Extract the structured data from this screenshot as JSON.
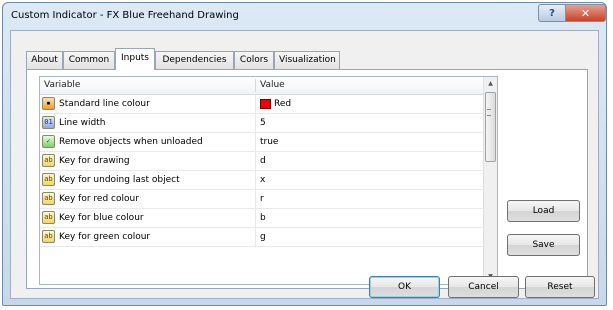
{
  "window": {
    "title": "Custom Indicator - FX Blue Freehand Drawing",
    "help_label": "?",
    "close_label": "✕"
  },
  "tabs": [
    {
      "label": "About",
      "active": false
    },
    {
      "label": "Common",
      "active": false
    },
    {
      "label": "Inputs",
      "active": true
    },
    {
      "label": "Dependencies",
      "active": false
    },
    {
      "label": "Colors",
      "active": false
    },
    {
      "label": "Visualization",
      "active": false
    }
  ],
  "grid": {
    "headers": {
      "variable": "Variable",
      "value": "Value"
    },
    "rows": [
      {
        "icon": "color-icon",
        "variable": "Standard line colour",
        "value": "Red",
        "swatch": "#ee0000"
      },
      {
        "icon": "number-icon",
        "variable": "Line width",
        "value": "5"
      },
      {
        "icon": "bool-icon",
        "variable": "Remove objects when unloaded",
        "value": "true"
      },
      {
        "icon": "text-icon",
        "variable": "Key for drawing",
        "value": "d"
      },
      {
        "icon": "text-icon",
        "variable": "Key for undoing last object",
        "value": "x"
      },
      {
        "icon": "text-icon",
        "variable": "Key for red colour",
        "value": "r"
      },
      {
        "icon": "text-icon",
        "variable": "Key for blue colour",
        "value": "b"
      },
      {
        "icon": "text-icon",
        "variable": "Key for green colour",
        "value": "g"
      }
    ]
  },
  "side_buttons": {
    "load": "Load",
    "save": "Save"
  },
  "footer_buttons": {
    "ok": "OK",
    "cancel": "Cancel",
    "reset": "Reset"
  },
  "colors": {
    "accent": "#3c7fb1",
    "titlebar": "#c6d9ec",
    "close": "#c7412a"
  }
}
